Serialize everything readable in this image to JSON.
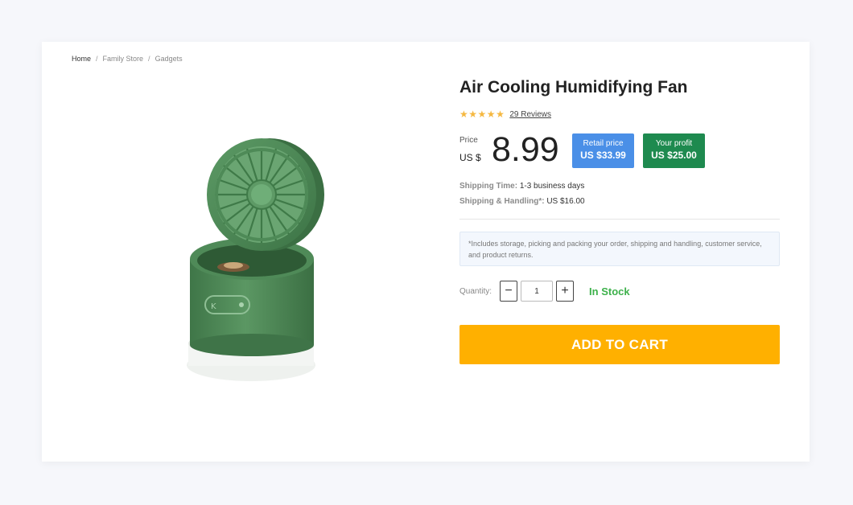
{
  "breadcrumb": {
    "home": "Home",
    "sep": "/",
    "category": "Family Store",
    "subcategory": "Gadgets"
  },
  "product": {
    "title": "Air Cooling Humidifying Fan",
    "rating_stars": 5,
    "reviews": "29 Reviews",
    "price_label": "Price",
    "currency": "US $",
    "price": "8.99",
    "retail_label": "Retail price",
    "retail_value": "US $33.99",
    "profit_label": "Your profit",
    "profit_value": "US $25.00",
    "shipping_time_label": "Shipping Time:",
    "shipping_time_value": "1-3 business days",
    "shipping_handling_label": "Shipping & Handling*:",
    "shipping_handling_value": "US $16.00",
    "note": "*Includes storage, picking and packing your order, shipping and handling, customer service, and product returns.",
    "quantity_label": "Quantity:",
    "quantity_value": "1",
    "minus": "−",
    "plus": "+",
    "stock_status": "In Stock",
    "add_to_cart": "ADD TO CART"
  },
  "colors": {
    "star": "#f5b841",
    "retail_badge": "#4a8fe7",
    "profit_badge": "#1e8a4f",
    "in_stock": "#3db14b",
    "add_to_cart": "#ffb000",
    "fan_green": "#4e8a57"
  },
  "icons": {
    "star": "star-icon",
    "product": "mini-fan-image"
  }
}
